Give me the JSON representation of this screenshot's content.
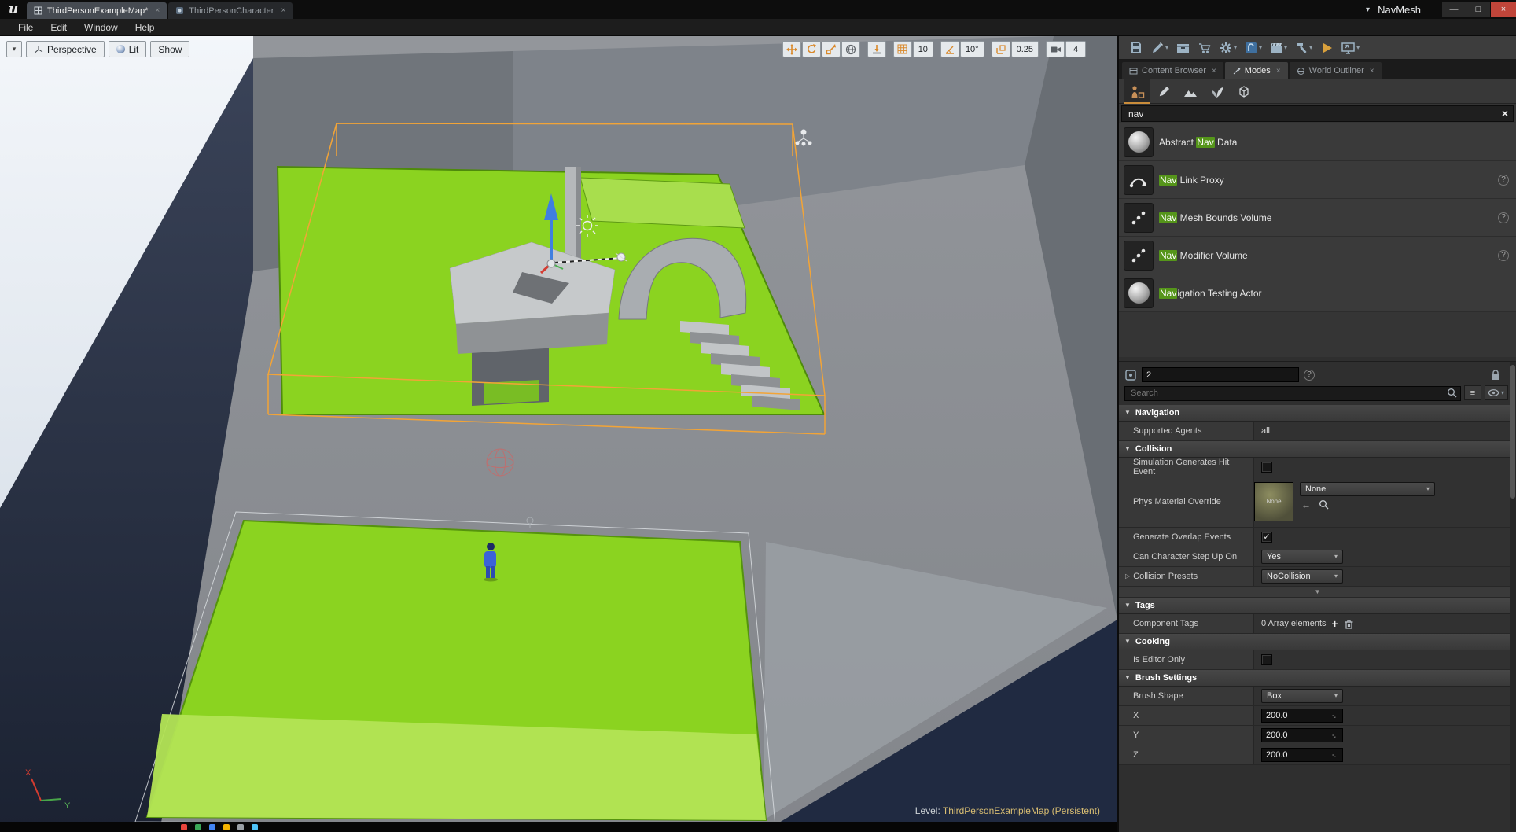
{
  "icons": {
    "logo": "u",
    "minimize": "—",
    "maximize": "□",
    "close": "×",
    "tab_close": "×",
    "caret_down": "▾",
    "clear": "×",
    "help": "?",
    "check": "✓",
    "plus": "+",
    "back_arrow": "←",
    "expander": "▼",
    "collapsed": "▷",
    "list": "≡",
    "drag": "↔"
  },
  "titlebar": {
    "tab1": "ThirdPersonExampleMap*",
    "tab2": "ThirdPersonCharacter",
    "right_label": "NavMesh"
  },
  "menubar": {
    "file": "File",
    "edit": "Edit",
    "window": "Window",
    "help": "Help"
  },
  "viewport": {
    "perspective": "Perspective",
    "lit": "Lit",
    "show": "Show",
    "grid_snap": "10",
    "rot_snap": "10°",
    "scale_snap": "0.25",
    "cam_speed": "4",
    "level_label": "Level:",
    "level_name": "ThirdPersonExampleMap (Persistent)",
    "axis_x": "X",
    "axis_y": "Y"
  },
  "tabs": {
    "content_browser": "Content Browser",
    "modes": "Modes",
    "world_outliner": "World Outliner"
  },
  "modes": {
    "search_value": "nav",
    "results": [
      {
        "pre": "Abstract ",
        "hl": "Nav",
        "post": " Data"
      },
      {
        "pre": "",
        "hl": "Nav",
        "post": " Link Proxy"
      },
      {
        "pre": "",
        "hl": "Nav",
        "post": " Mesh Bounds Volume"
      },
      {
        "pre": "",
        "hl": "Nav",
        "post": " Modifier Volume"
      },
      {
        "pre": "",
        "hl": "Nav",
        "post": "igation Testing Actor"
      }
    ]
  },
  "details": {
    "name_value": "2",
    "search_placeholder": "Search",
    "navigation": {
      "title": "Navigation",
      "agents_label": "Supported Agents",
      "agents_value": "all"
    },
    "collision": {
      "title": "Collision",
      "sim_label": "Simulation Generates Hit Event",
      "phys_label": "Phys Material Override",
      "phys_thumb_label": "None",
      "phys_value": "None",
      "overlap_label": "Generate Overlap Events",
      "step_label": "Can Character Step Up On",
      "step_value": "Yes",
      "presets_label": "Collision Presets",
      "presets_value": "NoCollision"
    },
    "tags": {
      "title": "Tags",
      "label": "Component Tags",
      "value": "0 Array elements"
    },
    "cooking": {
      "title": "Cooking",
      "label": "Is Editor Only"
    },
    "brush": {
      "title": "Brush Settings",
      "shape_label": "Brush Shape",
      "shape_value": "Box",
      "x_label": "X",
      "x_value": "200.0",
      "y_label": "Y",
      "y_value": "200.0",
      "z_label": "Z",
      "z_value": "200.0"
    }
  }
}
